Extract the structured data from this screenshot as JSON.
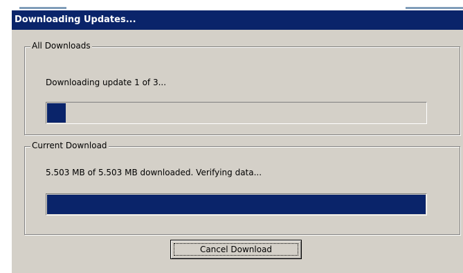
{
  "window": {
    "title": "Downloading Updates..."
  },
  "all_downloads": {
    "legend": "All Downloads",
    "status": "Downloading update 1 of 3...",
    "progress_fraction": 0.05
  },
  "current_download": {
    "legend": "Current Download",
    "status": "5.503 MB of 5.503 MB downloaded. Verifying data...",
    "progress_fraction": 1.0
  },
  "buttons": {
    "cancel_label": "Cancel Download"
  },
  "colors": {
    "titlebar": "#0a246a",
    "progress_fill": "#0a246a",
    "dialog_face": "#d4d0c8"
  }
}
